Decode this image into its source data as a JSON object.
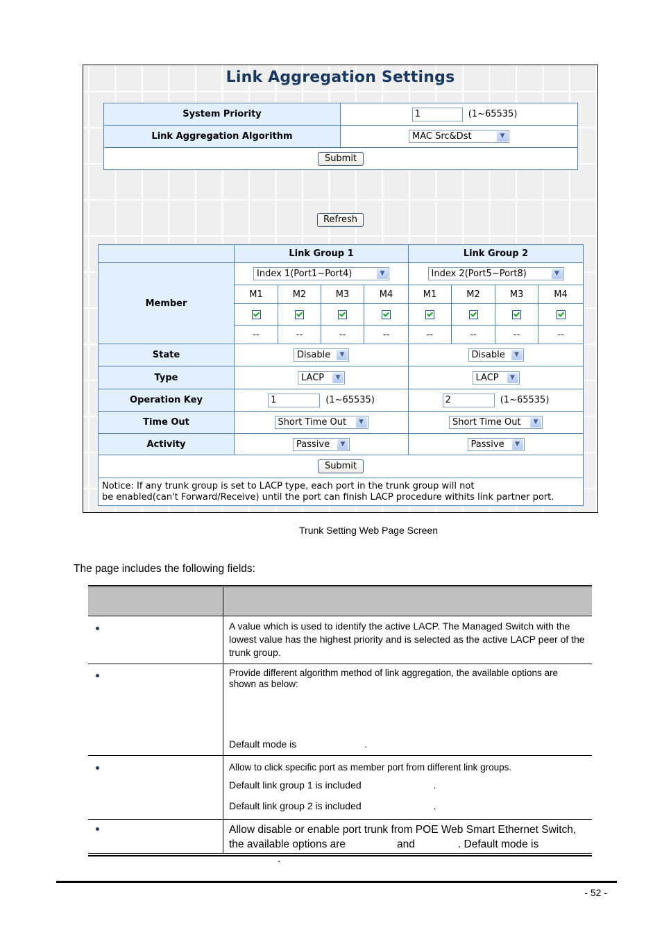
{
  "screenshot": {
    "title": "Link Aggregation Settings",
    "global": {
      "system_priority_label": "System Priority",
      "system_priority_value": "1",
      "system_priority_range": "(1~65535)",
      "algorithm_label": "Link Aggregation Algorithm",
      "algorithm_value": "MAC Src&Dst",
      "submit_label": "Submit"
    },
    "refresh_label": "Refresh",
    "groups_table": {
      "groups": [
        {
          "header": "Link Group 1",
          "index_select": "Index 1(Port1~Port4)",
          "members": [
            "M1",
            "M2",
            "M3",
            "M4"
          ],
          "checked": [
            true,
            true,
            true,
            true
          ],
          "status": [
            "--",
            "--",
            "--",
            "--"
          ],
          "state": "Disable",
          "type": "LACP",
          "operation_key": "1",
          "operation_key_range": "(1~65535)",
          "time_out": "Short Time Out",
          "activity": "Passive"
        },
        {
          "header": "Link Group 2",
          "index_select": "Index 2(Port5~Port8)",
          "members": [
            "M1",
            "M2",
            "M3",
            "M4"
          ],
          "checked": [
            true,
            true,
            true,
            true
          ],
          "status": [
            "--",
            "--",
            "--",
            "--"
          ],
          "state": "Disable",
          "type": "LACP",
          "operation_key": "2",
          "operation_key_range": "(1~65535)",
          "time_out": "Short Time Out",
          "activity": "Passive"
        }
      ],
      "row_labels": {
        "member": "Member",
        "state": "State",
        "type": "Type",
        "operation_key": "Operation Key",
        "time_out": "Time Out",
        "activity": "Activity"
      },
      "submit_label": "Submit",
      "notice_line1": "Notice: If any trunk group is set to LACP type, each port in the trunk group will not",
      "notice_line2": "be enabled(can't Forward/Receive) until the port can finish LACP procedure withits link partner port."
    }
  },
  "document": {
    "caption": "Trunk Setting Web Page Screen",
    "intro": "The page includes the following fields:",
    "fields_table": {
      "rows": [
        {
          "lines": [
            "A value which is used to identify the active LACP. The Managed Switch with the lowest value has the highest priority and is selected as the active LACP peer of the trunk group."
          ]
        },
        {
          "line1": "Provide different algorithm method of link aggregation, the available options are shown as below:",
          "default_prefix": "Default mode is",
          "default_suffix": "."
        },
        {
          "line1": "Allow to click specific port as member port from different link groups.",
          "line2_prefix": "Default link group 1 is included",
          "line2_suffix": ".",
          "line3_prefix": "Default link group 2 is included",
          "line3_suffix": "."
        },
        {
          "line1": "Allow disable or enable port trunk from POE Web Smart Ethernet Switch,",
          "line2_a": "the available options are",
          "line2_b": "and",
          "line2_c": ".  Default mode is",
          "line2_d": "."
        }
      ]
    },
    "page_number": "- 52 -"
  }
}
